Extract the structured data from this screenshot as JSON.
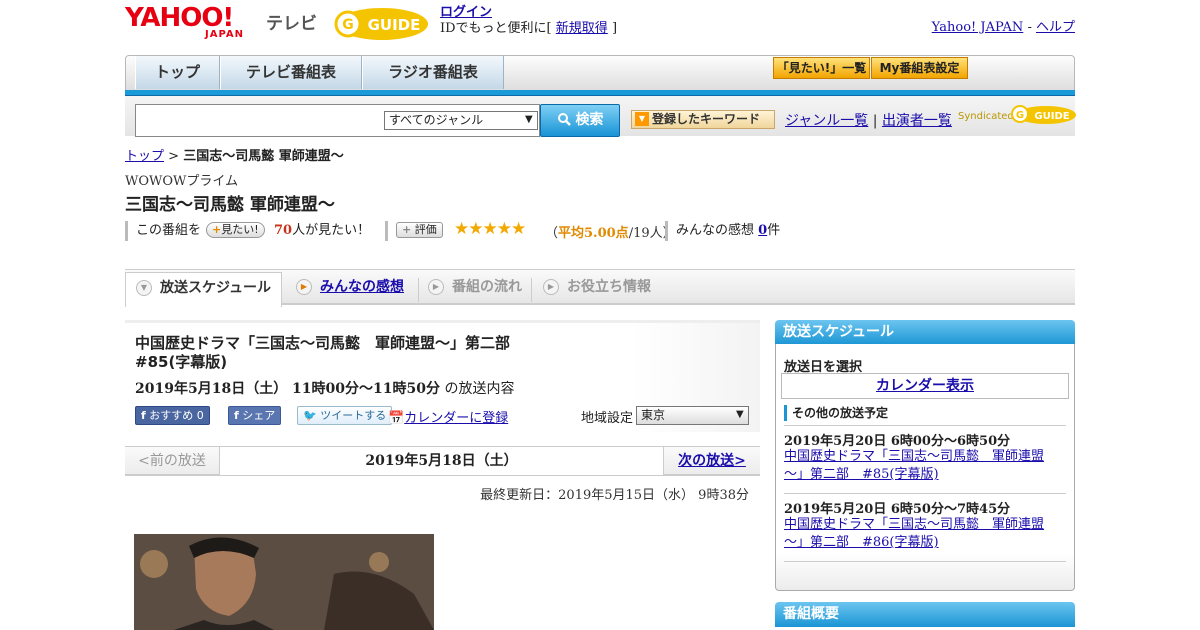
{
  "header": {
    "logo_yahoo": "YAHOO!",
    "logo_japan": "JAPAN",
    "logo_tv": "テレビ",
    "gguide": "GUIDE",
    "login_label": "ログイン",
    "login_prompt": "IDでもっと便利に[",
    "signup_label": "新規取得",
    "login_close": "]",
    "yahoo_japan_link": "Yahoo! JAPAN",
    "dash": "-",
    "help_link": "ヘルプ"
  },
  "nav": {
    "tabs": [
      {
        "label": "トップ"
      },
      {
        "label": "テレビ番組表"
      },
      {
        "label": "ラジオ番組表"
      }
    ],
    "miru_list": "「見たい!」一覧",
    "my_schedule": "My番組表設定"
  },
  "search": {
    "placeholder": "",
    "genre_selected": "すべてのジャンル",
    "search_button": "検索",
    "keyword_button": "登録したキーワード",
    "genre_list": "ジャンル一覧",
    "divider": "|",
    "cast_list": "出演者一覧",
    "syndicated": "Syndicated"
  },
  "breadcrumb": {
    "top": "トップ",
    "sep": ">",
    "current": "三国志～司馬懿 軍師連盟～"
  },
  "program": {
    "channel": "WOWOWプライム",
    "title": "三国志～司馬懿 軍師連盟～",
    "this_program": "この番組を",
    "want_button": "見たい!",
    "want_count": "70",
    "want_suffix": "人が見たい！",
    "rate_button": "評価",
    "stars": "★★★★★",
    "avg_open": "（",
    "avg_value": "平均5.00点",
    "avg_count": "/19人）",
    "impressions_label": "みんなの感想",
    "impressions_count": "0",
    "impressions_suffix": "件"
  },
  "tabs": [
    {
      "label": "放送スケジュール"
    },
    {
      "label": "みんなの感想"
    },
    {
      "label": "番組の流れ"
    },
    {
      "label": "お役立ち情報"
    }
  ],
  "episode": {
    "title": "中国歴史ドラマ「三国志～司馬懿　軍師連盟～」第二部　#85(字幕版)",
    "date": "2019年5月18日（土） 11時00分～11時50分",
    "date_suffix": "の放送内容",
    "fb_recommend": "おすすめ 0",
    "fb_share": "シェア",
    "tweet": "ツイートする",
    "calendar_register": "カレンダーに登録",
    "region_label": "地域設定",
    "region_selected": "東京"
  },
  "pager": {
    "prev": "<前の放送",
    "current": "2019年5月18日（土）",
    "next": "次の放送>"
  },
  "updated": "最終更新日：2019年5月15日（水） 9時38分",
  "sidebar": {
    "schedule_header": "放送スケジュール",
    "select_date": "放送日を選択",
    "calendar_button": "カレンダー表示",
    "other_schedule": "その他の放送予定",
    "items": [
      {
        "date": "2019年5月20日 6時00分～6時50分",
        "title": "中国歴史ドラマ「三国志～司馬懿　軍師連盟～」第二部　#85(字幕版)"
      },
      {
        "date": "2019年5月20日 6時50分～7時45分",
        "title": "中国歴史ドラマ「三国志～司馬懿　軍師連盟～」第二部　#86(字幕版)"
      }
    ],
    "summary_header": "番組概要"
  },
  "icons": {
    "search": "search-icon",
    "star": "star-icon",
    "calendar": "calendar-icon",
    "play": "play-icon"
  },
  "colors": {
    "accent_blue": "#1a9ad8",
    "yahoo_red": "#e60012",
    "orange": "#f2a400",
    "link": "#1a0dab"
  }
}
